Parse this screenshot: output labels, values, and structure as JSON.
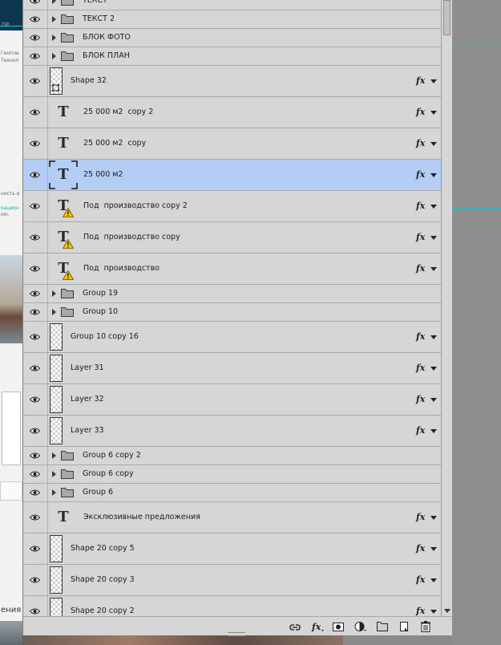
{
  "background": {
    "left_top_text": "ПР",
    "left_lines": [
      "Генпла",
      "Технол",
      "ность в",
      "кацион",
      "ом,"
    ],
    "bottom_text": "ения"
  },
  "panel": {
    "accent_selected": "#b4cdf5",
    "fx_label": "fx",
    "layers": [
      {
        "name": "ТЕКСТ",
        "kind": "group"
      },
      {
        "name": "ТЕКСТ 2",
        "kind": "group"
      },
      {
        "name": "БЛОК ФОТО",
        "kind": "group"
      },
      {
        "name": "БЛОК ПЛАН",
        "kind": "group"
      },
      {
        "name": "Shape 32",
        "kind": "shape",
        "fx": true
      },
      {
        "name": "25 000 м2  copy 2",
        "kind": "text",
        "fx": true
      },
      {
        "name": "25 000 м2  copy",
        "kind": "text",
        "fx": true
      },
      {
        "name": "25 000 м2",
        "kind": "text",
        "fx": true,
        "selected": true
      },
      {
        "name": "Под  производство copy 2",
        "kind": "text-warn",
        "fx": true
      },
      {
        "name": "Под  производство copy",
        "kind": "text-warn",
        "fx": true
      },
      {
        "name": "Под  производство",
        "kind": "text-warn",
        "fx": true
      },
      {
        "name": "Group 19",
        "kind": "group"
      },
      {
        "name": "Group 10",
        "kind": "group"
      },
      {
        "name": "Group 10 copy 16",
        "kind": "pixel",
        "fx": true
      },
      {
        "name": "Layer 31",
        "kind": "pixel",
        "fx": true
      },
      {
        "name": "Layer 32",
        "kind": "pixel",
        "fx": true
      },
      {
        "name": "Layer 33",
        "kind": "pixel",
        "fx": true
      },
      {
        "name": "Group 6 copy 2",
        "kind": "group"
      },
      {
        "name": "Group 6 copy",
        "kind": "group"
      },
      {
        "name": "Group 6",
        "kind": "group"
      },
      {
        "name": "Эксклюзивные предложения",
        "kind": "text",
        "fx": true
      },
      {
        "name": "Shape 20 copy 5",
        "kind": "pixel",
        "fx": true
      },
      {
        "name": "Shape 20 copy 3",
        "kind": "pixel",
        "fx": true
      },
      {
        "name": "Shape 20 copy 2",
        "kind": "pixel",
        "fx": true
      }
    ],
    "toolbar": [
      {
        "icon": "link-layers-icon"
      },
      {
        "icon": "fx-icon"
      },
      {
        "icon": "layer-mask-icon"
      },
      {
        "icon": "adjustment-layer-icon"
      },
      {
        "icon": "new-group-icon"
      },
      {
        "icon": "new-layer-icon"
      },
      {
        "icon": "trash-icon"
      }
    ]
  }
}
